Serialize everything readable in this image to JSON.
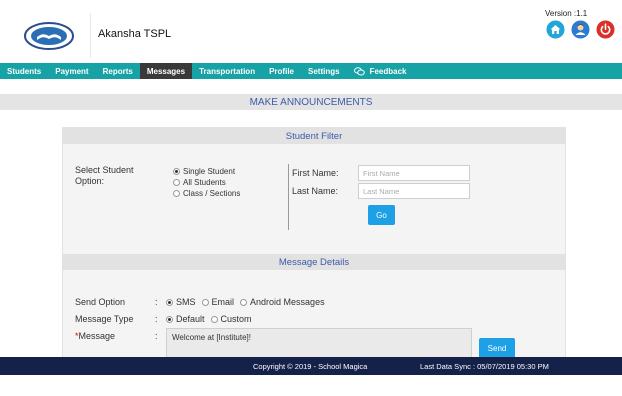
{
  "header": {
    "org_name": "Akansha TSPL",
    "version": "Version :1.1",
    "icons": [
      "home-icon",
      "user-icon",
      "power-icon"
    ]
  },
  "nav": {
    "items": [
      {
        "label": "Students"
      },
      {
        "label": "Payment"
      },
      {
        "label": "Reports"
      },
      {
        "label": "Messages",
        "active": true
      },
      {
        "label": "Transportation"
      },
      {
        "label": "Profile"
      },
      {
        "label": "Settings"
      },
      {
        "label": "Feedback",
        "icon": "chat-icon"
      }
    ]
  },
  "page_title": "MAKE ANNOUNCEMENTS",
  "student_filter": {
    "heading": "Student Filter",
    "option_label": "Select Student Option:",
    "options": [
      {
        "label": "Single Student",
        "selected": true
      },
      {
        "label": "All Students",
        "selected": false
      },
      {
        "label": "Class / Sections",
        "selected": false
      }
    ],
    "first_name_label": "First Name:",
    "first_name_placeholder": "First Name",
    "last_name_label": "Last Name:",
    "last_name_placeholder": "Last Name",
    "go_label": "Go"
  },
  "message_details": {
    "heading": "Message Details",
    "send_option_label": "Send Option",
    "send_options": [
      {
        "label": "SMS",
        "selected": true
      },
      {
        "label": "Email",
        "selected": false
      },
      {
        "label": "Android Messages",
        "selected": false
      }
    ],
    "message_type_label": "Message Type",
    "message_types": [
      {
        "label": "Default",
        "selected": true
      },
      {
        "label": "Custom",
        "selected": false
      }
    ],
    "message_label": "Message",
    "required_mark": "*",
    "colon": ":",
    "message_value": "Welcome at [Institute]!",
    "send_label": "Send"
  },
  "footer": {
    "copyright": "Copyright © 2019 - School Magica",
    "last_sync": "Last Data Sync : 05/07/2019 05:30 PM"
  },
  "colors": {
    "nav_bg": "#17a2a6",
    "nav_active": "#3a3a3a",
    "accent_blue": "#1da0e6",
    "heading_text": "#3e5aa8",
    "footer_bg": "#14224a"
  }
}
